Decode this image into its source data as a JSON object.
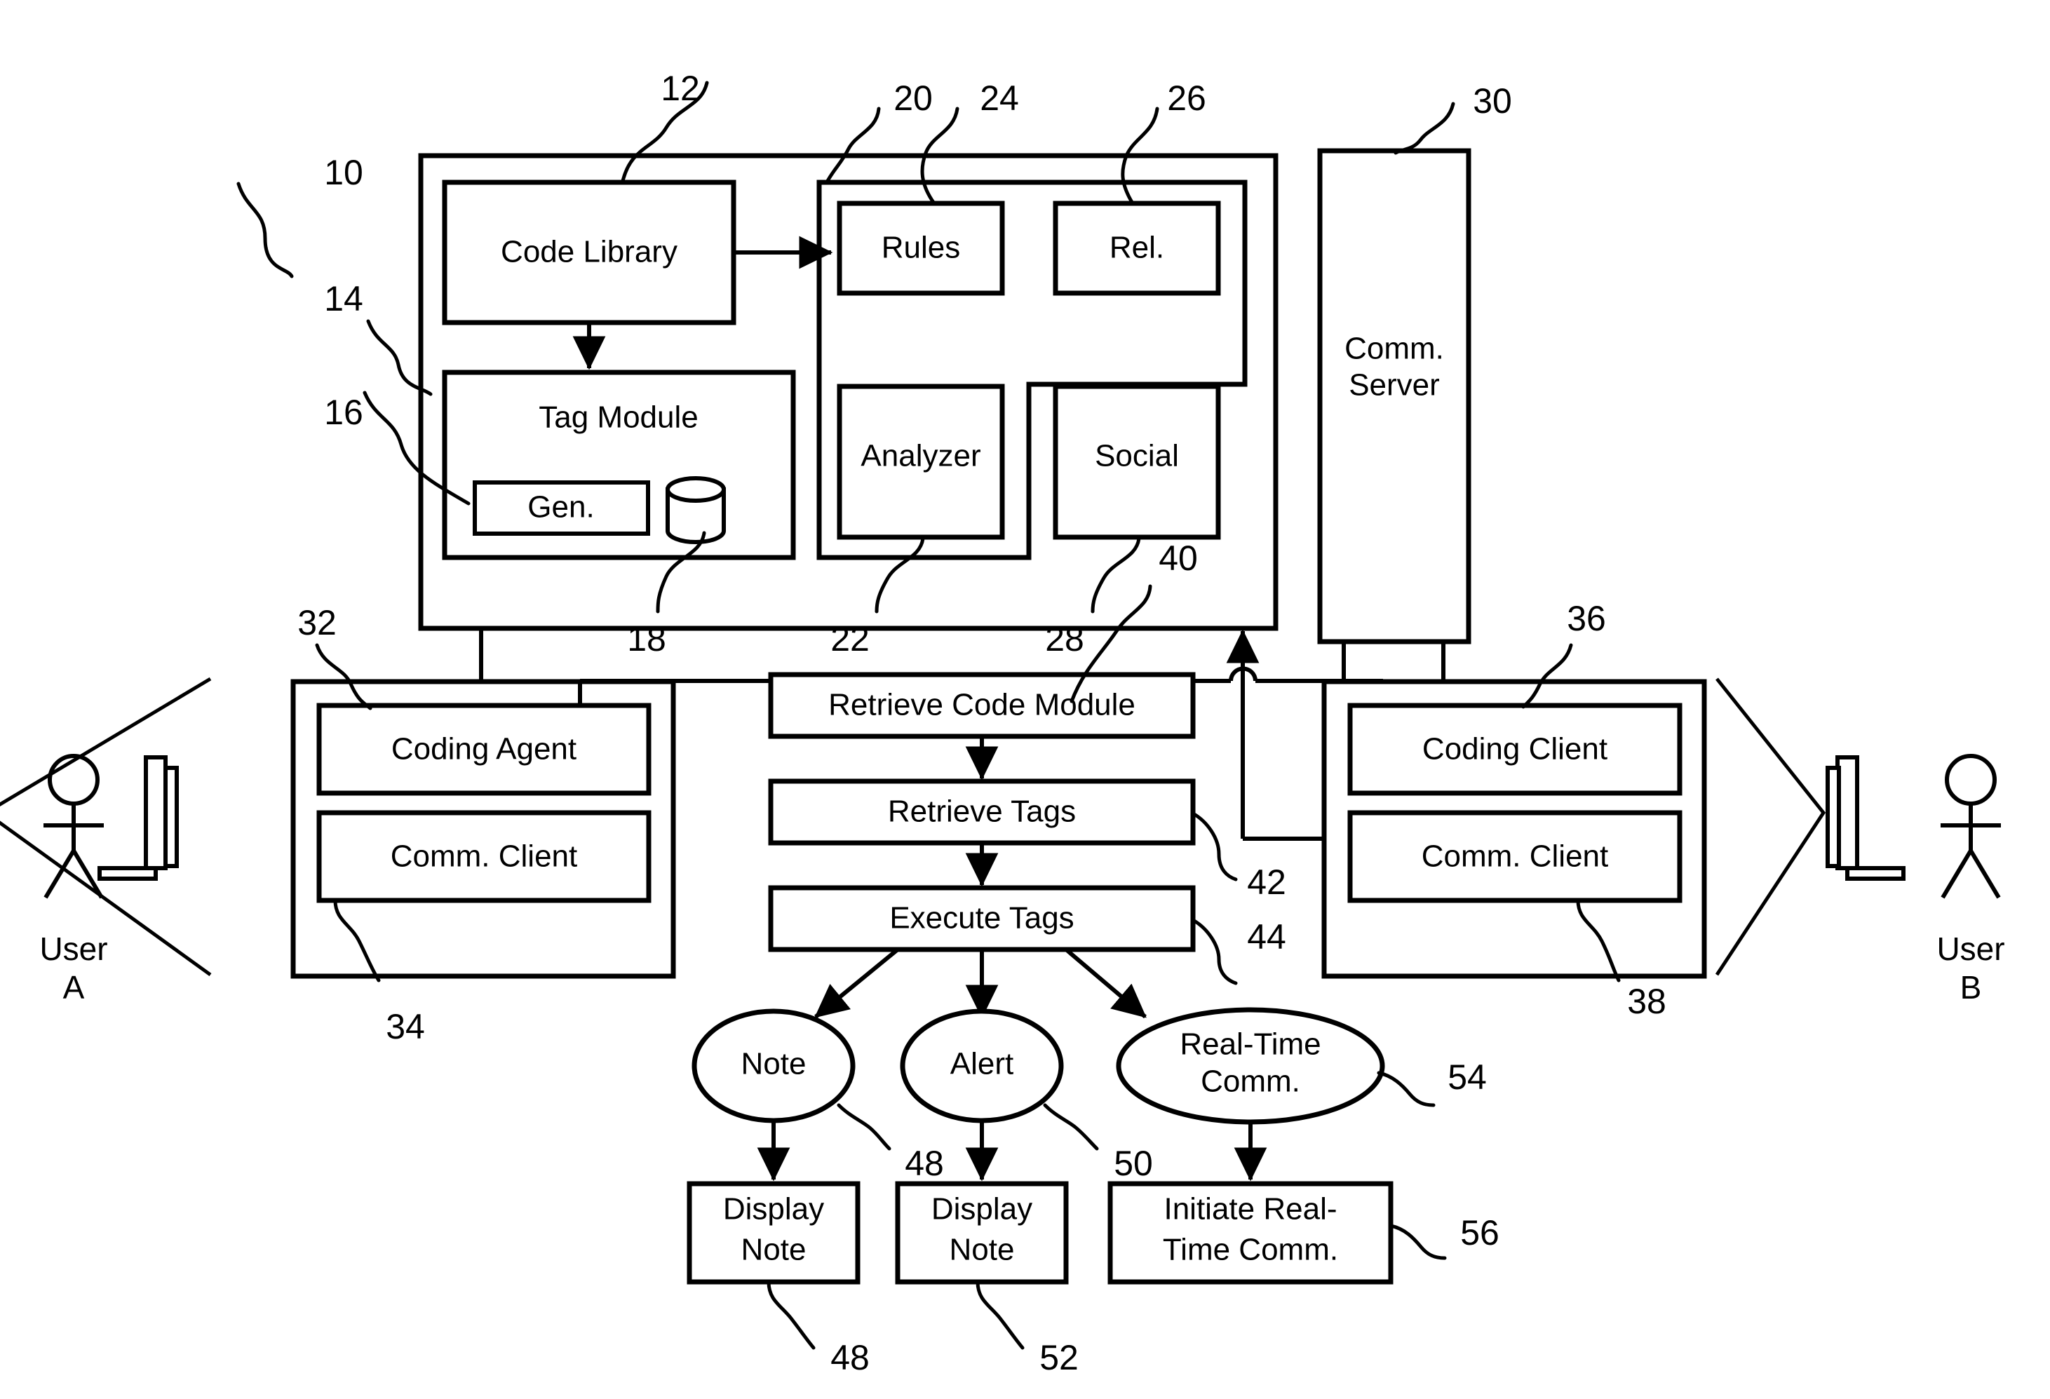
{
  "figure": {
    "kind": "patent-block-diagram",
    "background": "#ffffff",
    "ink": "#000000"
  },
  "blocks": {
    "code_library": "Code Library",
    "tag_module": "Tag Module",
    "gen": "Gen.",
    "rules": "Rules",
    "rel": "Rel.",
    "analyzer": "Analyzer",
    "social": "Social",
    "comm_server_line1": "Comm.",
    "comm_server_line2": "Server",
    "coding_agent": "Coding Agent",
    "comm_client_left": "Comm. Client",
    "coding_client": "Coding Client",
    "comm_client_right": "Comm. Client",
    "retrieve_code_module": "Retrieve Code Module",
    "retrieve_tags": "Retrieve Tags",
    "execute_tags": "Execute Tags",
    "note": "Note",
    "alert": "Alert",
    "real_time_comm_line1": "Real-Time",
    "real_time_comm_line2": "Comm.",
    "display_note_1_line1": "Display",
    "display_note_1_line2": "Note",
    "display_note_2_line1": "Display",
    "display_note_2_line2": "Note",
    "initiate_rtc_line1": "Initiate Real-",
    "initiate_rtc_line2": "Time Comm."
  },
  "actors": {
    "user_a_line1": "User",
    "user_a_line2": "A",
    "user_b_line1": "User",
    "user_b_line2": "B"
  },
  "reference_numerals": {
    "n10": "10",
    "n12": "12",
    "n14": "14",
    "n16": "16",
    "n18": "18",
    "n20": "20",
    "n22": "22",
    "n24": "24",
    "n26": "26",
    "n28": "28",
    "n30": "30",
    "n32": "32",
    "n34": "34",
    "n36": "36",
    "n38": "38",
    "n40": "40",
    "n42": "42",
    "n44": "44",
    "n48a": "48",
    "n48b": "48",
    "n50": "50",
    "n52": "52",
    "n54": "54",
    "n56": "56"
  }
}
